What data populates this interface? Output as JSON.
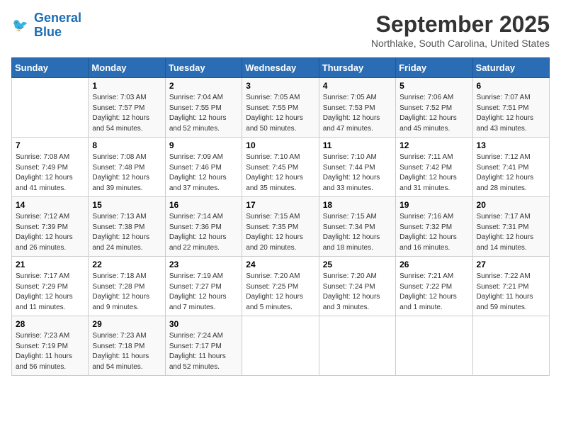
{
  "app": {
    "logo_line1": "General",
    "logo_line2": "Blue"
  },
  "title": "September 2025",
  "location": "Northlake, South Carolina, United States",
  "days_of_week": [
    "Sunday",
    "Monday",
    "Tuesday",
    "Wednesday",
    "Thursday",
    "Friday",
    "Saturday"
  ],
  "weeks": [
    [
      {
        "day": "",
        "info": ""
      },
      {
        "day": "1",
        "info": "Sunrise: 7:03 AM\nSunset: 7:57 PM\nDaylight: 12 hours\nand 54 minutes."
      },
      {
        "day": "2",
        "info": "Sunrise: 7:04 AM\nSunset: 7:55 PM\nDaylight: 12 hours\nand 52 minutes."
      },
      {
        "day": "3",
        "info": "Sunrise: 7:05 AM\nSunset: 7:55 PM\nDaylight: 12 hours\nand 50 minutes."
      },
      {
        "day": "4",
        "info": "Sunrise: 7:05 AM\nSunset: 7:53 PM\nDaylight: 12 hours\nand 47 minutes."
      },
      {
        "day": "5",
        "info": "Sunrise: 7:06 AM\nSunset: 7:52 PM\nDaylight: 12 hours\nand 45 minutes."
      },
      {
        "day": "6",
        "info": "Sunrise: 7:07 AM\nSunset: 7:51 PM\nDaylight: 12 hours\nand 43 minutes."
      }
    ],
    [
      {
        "day": "7",
        "info": "Sunrise: 7:08 AM\nSunset: 7:49 PM\nDaylight: 12 hours\nand 41 minutes."
      },
      {
        "day": "8",
        "info": "Sunrise: 7:08 AM\nSunset: 7:48 PM\nDaylight: 12 hours\nand 39 minutes."
      },
      {
        "day": "9",
        "info": "Sunrise: 7:09 AM\nSunset: 7:46 PM\nDaylight: 12 hours\nand 37 minutes."
      },
      {
        "day": "10",
        "info": "Sunrise: 7:10 AM\nSunset: 7:45 PM\nDaylight: 12 hours\nand 35 minutes."
      },
      {
        "day": "11",
        "info": "Sunrise: 7:10 AM\nSunset: 7:44 PM\nDaylight: 12 hours\nand 33 minutes."
      },
      {
        "day": "12",
        "info": "Sunrise: 7:11 AM\nSunset: 7:42 PM\nDaylight: 12 hours\nand 31 minutes."
      },
      {
        "day": "13",
        "info": "Sunrise: 7:12 AM\nSunset: 7:41 PM\nDaylight: 12 hours\nand 28 minutes."
      }
    ],
    [
      {
        "day": "14",
        "info": "Sunrise: 7:12 AM\nSunset: 7:39 PM\nDaylight: 12 hours\nand 26 minutes."
      },
      {
        "day": "15",
        "info": "Sunrise: 7:13 AM\nSunset: 7:38 PM\nDaylight: 12 hours\nand 24 minutes."
      },
      {
        "day": "16",
        "info": "Sunrise: 7:14 AM\nSunset: 7:36 PM\nDaylight: 12 hours\nand 22 minutes."
      },
      {
        "day": "17",
        "info": "Sunrise: 7:15 AM\nSunset: 7:35 PM\nDaylight: 12 hours\nand 20 minutes."
      },
      {
        "day": "18",
        "info": "Sunrise: 7:15 AM\nSunset: 7:34 PM\nDaylight: 12 hours\nand 18 minutes."
      },
      {
        "day": "19",
        "info": "Sunrise: 7:16 AM\nSunset: 7:32 PM\nDaylight: 12 hours\nand 16 minutes."
      },
      {
        "day": "20",
        "info": "Sunrise: 7:17 AM\nSunset: 7:31 PM\nDaylight: 12 hours\nand 14 minutes."
      }
    ],
    [
      {
        "day": "21",
        "info": "Sunrise: 7:17 AM\nSunset: 7:29 PM\nDaylight: 12 hours\nand 11 minutes."
      },
      {
        "day": "22",
        "info": "Sunrise: 7:18 AM\nSunset: 7:28 PM\nDaylight: 12 hours\nand 9 minutes."
      },
      {
        "day": "23",
        "info": "Sunrise: 7:19 AM\nSunset: 7:27 PM\nDaylight: 12 hours\nand 7 minutes."
      },
      {
        "day": "24",
        "info": "Sunrise: 7:20 AM\nSunset: 7:25 PM\nDaylight: 12 hours\nand 5 minutes."
      },
      {
        "day": "25",
        "info": "Sunrise: 7:20 AM\nSunset: 7:24 PM\nDaylight: 12 hours\nand 3 minutes."
      },
      {
        "day": "26",
        "info": "Sunrise: 7:21 AM\nSunset: 7:22 PM\nDaylight: 12 hours\nand 1 minute."
      },
      {
        "day": "27",
        "info": "Sunrise: 7:22 AM\nSunset: 7:21 PM\nDaylight: 11 hours\nand 59 minutes."
      }
    ],
    [
      {
        "day": "28",
        "info": "Sunrise: 7:23 AM\nSunset: 7:19 PM\nDaylight: 11 hours\nand 56 minutes."
      },
      {
        "day": "29",
        "info": "Sunrise: 7:23 AM\nSunset: 7:18 PM\nDaylight: 11 hours\nand 54 minutes."
      },
      {
        "day": "30",
        "info": "Sunrise: 7:24 AM\nSunset: 7:17 PM\nDaylight: 11 hours\nand 52 minutes."
      },
      {
        "day": "",
        "info": ""
      },
      {
        "day": "",
        "info": ""
      },
      {
        "day": "",
        "info": ""
      },
      {
        "day": "",
        "info": ""
      }
    ]
  ]
}
